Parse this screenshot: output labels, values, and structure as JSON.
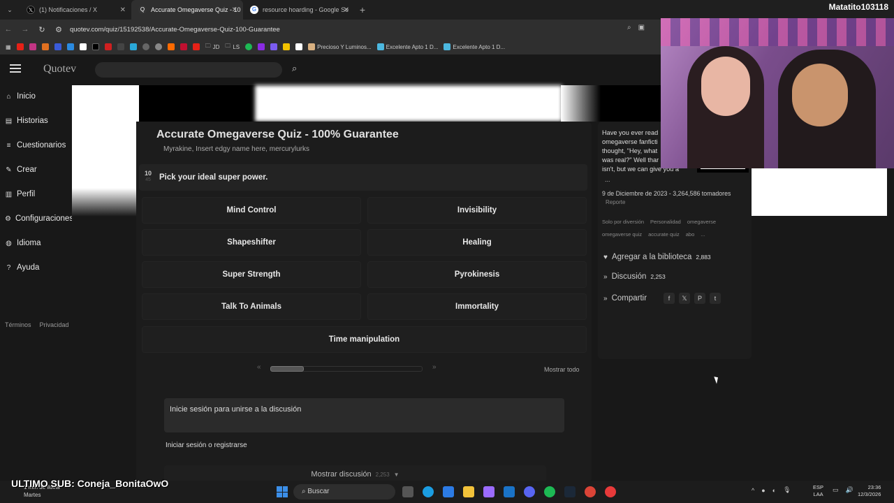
{
  "browser": {
    "tabs": [
      {
        "title": "(1) Notificaciones / X",
        "icon": "x-icon",
        "active": false
      },
      {
        "title": "Accurate Omegaverse Quiz - 10",
        "icon": "quotev-icon",
        "active": true
      },
      {
        "title": "resource hoarding - Google Se",
        "icon": "google-icon",
        "active": false
      }
    ],
    "url": "quotev.com/quiz/15192538/Accurate-Omegaverse-Quiz-100-Guarantee",
    "bookmarks": [
      "JD",
      "LS",
      "Precioso Y Luminos...",
      "Excelente Apto 1 D...",
      "Excelente Apto 1 D..."
    ]
  },
  "overlay": {
    "streamer_name": "Matatito103118",
    "last_sub": "ULTIMO SUB: Coneja_BonitaOwO"
  },
  "site": {
    "logo": "Quotev",
    "sidebar": [
      {
        "label": "Inicio",
        "icon": "home-icon"
      },
      {
        "label": "Historias",
        "icon": "book-icon"
      },
      {
        "label": "Cuestionarios",
        "icon": "list-icon"
      },
      {
        "label": "Crear",
        "icon": "pencil-icon"
      },
      {
        "label": "Perfil",
        "icon": "profile-icon"
      },
      {
        "label": "Configuraciones",
        "icon": "gear-icon"
      },
      {
        "label": "Idioma",
        "icon": "globe-icon"
      },
      {
        "label": "Ayuda",
        "icon": "help-icon"
      }
    ],
    "footer": {
      "terms": "Términos",
      "privacy": "Privacidad"
    }
  },
  "quiz": {
    "title": "Accurate Omegaverse Quiz - 100% Guarantee",
    "authors": "Myrakine, Insert edgy name here, mercurylurks",
    "question_number": "10",
    "question_total": "45",
    "question": "Pick your ideal super power.",
    "answers": [
      "Mind Control",
      "Invisibility",
      "Shapeshifter",
      "Healing",
      "Super Strength",
      "Pyrokinesis",
      "Talk To Animals",
      "Immortality",
      "Time manipulation"
    ],
    "pager_prev": "«",
    "pager_next": "»",
    "progress": 0.22,
    "show_all": "Mostrar todo",
    "login_prompt": "Inicie sesión para unirse a la discusión",
    "login_button": "Iniciar sesión o registrarse",
    "show_discussion": "Mostrar discusión",
    "discussion_count": "2,253"
  },
  "details": {
    "description_lines": [
      "Have you ever read",
      "omegaverse fanficti",
      "thought, \"Hey, what",
      "was real?\" Well thar",
      "isn't, but we can give you a"
    ],
    "more": "...",
    "date_line": "9 de Diciembre de 2023 - 3,264,586 tomadores",
    "report": "Reporte",
    "tags_row1": [
      "Solo por diversión",
      "Personalidad",
      "omegaverse"
    ],
    "tags_row2": [
      "omegaverse quiz",
      "accurate quiz",
      "abo",
      "..."
    ],
    "add_library": "Agregar a la biblioteca",
    "add_library_count": "2,883",
    "discussion": "Discusión",
    "discussion_count": "2,253",
    "share": "Compartir"
  },
  "taskbar": {
    "weather_line1": "1 mm de lluvia",
    "weather_line2": "Martes",
    "search": "Buscar",
    "lang1": "ESP",
    "lang2": "LAA",
    "time": "23:36",
    "date": "12/3/2026"
  }
}
